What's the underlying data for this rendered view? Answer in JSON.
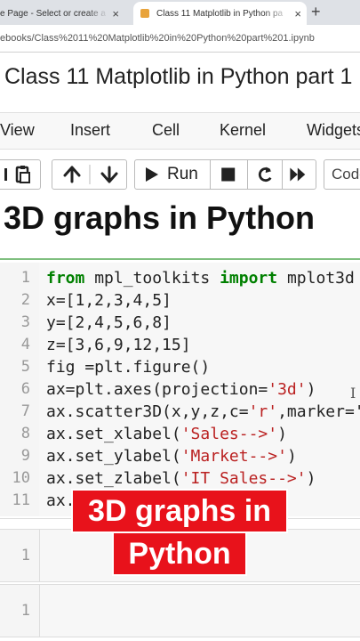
{
  "browser": {
    "tabs": [
      {
        "label": "e Page - Select or create a n",
        "active": false
      },
      {
        "label": "Class 11 Matplotlib in Python pa",
        "active": true
      }
    ],
    "new_tab": "+",
    "close": "×",
    "url": "ebooks/Class%2011%20Matplotlib%20in%20Python%20part%201.ipynb"
  },
  "notebook": {
    "title": "Class 11 Matplotlib in Python part 1"
  },
  "menu": [
    "View",
    "Insert",
    "Cell",
    "Kernel",
    "Widgets"
  ],
  "toolbar": {
    "run_label": "Run",
    "cell_type": "Code"
  },
  "heading": "3D graphs in Python",
  "code_cell": {
    "lines": [
      {
        "n": "1",
        "kw1": "from",
        "mid": " mpl_toolkits ",
        "kw2": "import",
        "rest": " mplot3d"
      },
      {
        "n": "2",
        "text": "x=[1,2,3,4,5]"
      },
      {
        "n": "3",
        "text": "y=[2,4,5,6,8]"
      },
      {
        "n": "4",
        "text": "z=[3,6,9,12,15]"
      },
      {
        "n": "5",
        "text": "fig =plt.figure()"
      },
      {
        "n": "6",
        "pre": "ax=plt.axes(projection=",
        "str": "'3d'",
        "post": ")"
      },
      {
        "n": "7",
        "pre": "ax.scatter3D(x,y,z,c=",
        "str": "'r'",
        "post": ",marker='"
      },
      {
        "n": "8",
        "pre": "ax.set_xlabel(",
        "str": "'Sales-->'",
        "post": ")"
      },
      {
        "n": "9",
        "pre": "ax.set_ylabel(",
        "str": "'Market-->'",
        "post": ")"
      },
      {
        "n": "10",
        "pre": "ax.set_zlabel(",
        "str": "'IT Sales-->'",
        "post": ")"
      },
      {
        "n": "11",
        "text": "ax."
      }
    ]
  },
  "overlay_caption": {
    "line1": "3D graphs in",
    "line2": "Python"
  },
  "empty_cells": [
    {
      "n": "1"
    },
    {
      "n": "1"
    }
  ],
  "colors": {
    "overlay": "#e8121b",
    "keyword": "#008000",
    "string": "#ba2121",
    "active_cell_border": "#7fbf7f"
  }
}
